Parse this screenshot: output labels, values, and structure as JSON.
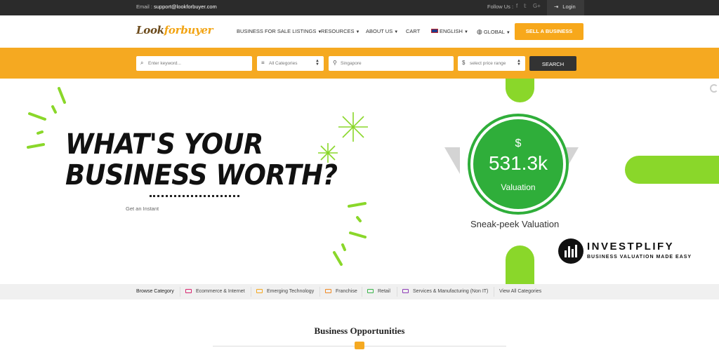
{
  "topbar": {
    "email_label": "Email :",
    "email": "support@lookforbuyer.com",
    "follow": "Follow Us :",
    "social": [
      "f",
      "𝕥",
      "G+"
    ],
    "login": "Login"
  },
  "header": {
    "logo_a": "Look",
    "logo_b": "forbuyer",
    "nav": [
      {
        "label": "BUSINESS FOR SALE LISTINGS",
        "dropdown": true
      },
      {
        "label": "RESOURCES",
        "dropdown": true
      },
      {
        "label": "ABOUT US",
        "dropdown": true
      },
      {
        "label": "CART",
        "dropdown": false
      },
      {
        "label": "ENGLISH",
        "dropdown": true
      },
      {
        "label": "GLOBAL",
        "dropdown": true
      }
    ],
    "sell_button": "SELL A BUSINESS"
  },
  "search": {
    "keyword_placeholder": "Enter keyword...",
    "category": "All Categories",
    "location": "Singapore",
    "price": "select price range",
    "button": "SEARCH"
  },
  "hero": {
    "title_line1": "WHAT'S YOUR",
    "title_line2": "BUSINESS WORTH?",
    "subtitle": "Get an Instant",
    "currency": "$",
    "valuation_value": "531.3k",
    "valuation_label": "Valuation",
    "sneak_peek": "Sneak-peek Valuation",
    "brand_name": "INVESTPLIFY",
    "brand_tagline": "BUSINESS VALUATION MADE EASY"
  },
  "categories": {
    "browse": "Browse Category",
    "items": [
      {
        "label": "Ecommerce & Internet",
        "color": "#d9266f"
      },
      {
        "label": "Emerging Technology",
        "color": "#f5a921"
      },
      {
        "label": "Franchise",
        "color": "#f08a24"
      },
      {
        "label": "Retail",
        "color": "#3bb54a"
      },
      {
        "label": "Services & Manufacturing (Non IT)",
        "color": "#8e3db8"
      }
    ],
    "view_all": "View All Categories"
  },
  "opportunities": {
    "title": "Business Opportunities"
  },
  "colors": {
    "accent": "#f5a921",
    "green": "#2fae3a",
    "lime": "#8ad72a",
    "dark": "#2b2b2b"
  }
}
